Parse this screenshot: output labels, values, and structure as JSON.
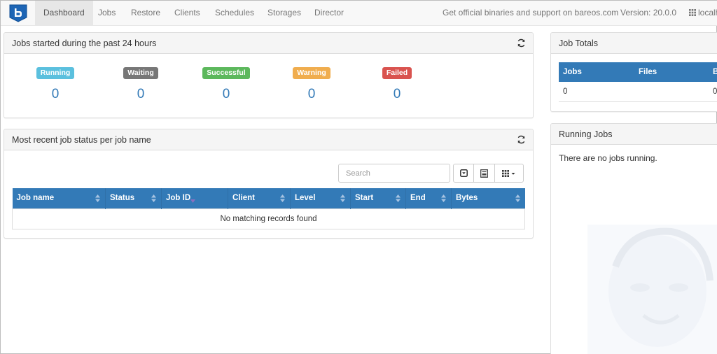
{
  "navbar": {
    "items": [
      {
        "label": "Dashboard"
      },
      {
        "label": "Jobs"
      },
      {
        "label": "Restore"
      },
      {
        "label": "Clients"
      },
      {
        "label": "Schedules"
      },
      {
        "label": "Storages"
      },
      {
        "label": "Director"
      }
    ],
    "support_text": "Get official binaries and support on bareos.com",
    "version": "Version: 20.0.0",
    "host": "localh"
  },
  "jobs_24h": {
    "title": "Jobs started during the past 24 hours",
    "stats": [
      {
        "label": "Running",
        "count": "0",
        "color": "#5bc0de"
      },
      {
        "label": "Waiting",
        "count": "0",
        "color": "#777777"
      },
      {
        "label": "Successful",
        "count": "0",
        "color": "#5cb85c"
      },
      {
        "label": "Warning",
        "count": "0",
        "color": "#f0ad4e"
      },
      {
        "label": "Failed",
        "count": "0",
        "color": "#d9534f"
      }
    ]
  },
  "recent": {
    "title": "Most recent job status per job name",
    "search_placeholder": "Search",
    "columns": [
      "Job name",
      "Status",
      "Job ID",
      "Client",
      "Level",
      "Start",
      "End",
      "Bytes"
    ],
    "empty_message": "No matching records found"
  },
  "job_totals": {
    "title": "Job Totals",
    "columns": [
      "Jobs",
      "Files",
      "B"
    ],
    "values": [
      "0",
      "",
      "0"
    ]
  },
  "running_jobs": {
    "title": "Running Jobs",
    "message": "There are no jobs running."
  },
  "colors": {
    "primary": "#337ab7",
    "navbar_bg": "#f8f8f8",
    "panel_heading_bg": "#f5f5f5"
  }
}
